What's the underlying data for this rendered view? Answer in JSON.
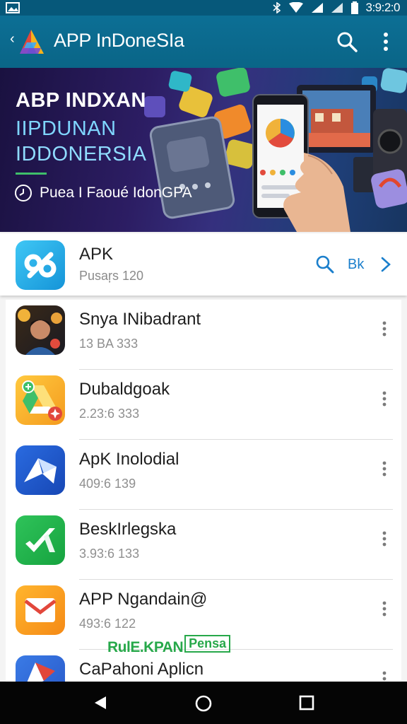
{
  "status_bar": {
    "time": "3:9:2:0"
  },
  "app_bar": {
    "back_glyph": "‹",
    "title": "APP InDoneSIa"
  },
  "banner": {
    "line1": "ABP INDXAN",
    "line2": "IIPDUNAN",
    "line3": "IDDONERSIA",
    "tagline": "Puea I Faoué IdonGPA"
  },
  "featured": {
    "name": "APK",
    "subtitle": "Pusaŗs 120",
    "action": "Bk"
  },
  "apps": [
    {
      "name": "Snya INibadrant",
      "meta": "13 BA  333",
      "icon": "person-photo-icon"
    },
    {
      "name": "Dubaldgoak",
      "meta": "2.23:6  333",
      "icon": "drive-like-icon"
    },
    {
      "name": "ApK Inolodial",
      "meta": "409:6  139",
      "icon": "origami-bird-icon"
    },
    {
      "name": "BeskIrlegska",
      "meta": "3.93:6  133",
      "icon": "green-check-icon"
    },
    {
      "name": "APP Ngandain@",
      "meta": "493:6  122",
      "icon": "orange-mail-icon"
    },
    {
      "name": "CaPahoni Aplicn",
      "meta": "",
      "icon": "partial-app-icon"
    }
  ],
  "watermark": {
    "left": "RulE.KPAN",
    "right": "Pensa"
  },
  "colors": {
    "app_bar": "#0a6587",
    "accent": "#1b7fcc",
    "nav": "#050505"
  }
}
